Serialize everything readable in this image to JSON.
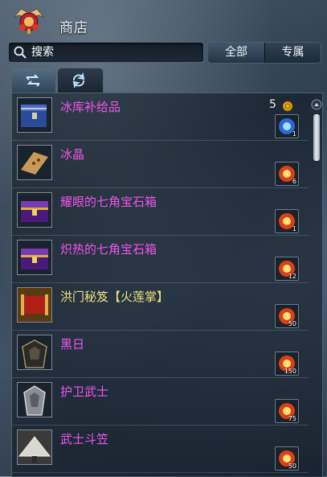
{
  "header": {
    "title": "商店",
    "logo_icon": "lantern-crest-icon"
  },
  "search": {
    "placeholder": "搜索",
    "value": ""
  },
  "filter": {
    "all_label": "全部",
    "own_label": "专属",
    "selected": "全部"
  },
  "tabs": [
    {
      "icon": "swap-arrows-icon",
      "active": true
    },
    {
      "icon": "refresh-icon",
      "active": false
    }
  ],
  "list": {
    "price": "5",
    "price_icon": "gold-coin-icon",
    "items": [
      {
        "name": "冰库补给品",
        "icon": "blue-chest-icon",
        "currency_icon": "blue-orb-icon",
        "qty": "1",
        "color": "#ee55ee"
      },
      {
        "name": "冰晶",
        "icon": "crystal-scroll-icon",
        "currency_icon": "fire-orb-icon",
        "qty": "6",
        "color": "#ee55ee"
      },
      {
        "name": "耀眼的七角宝石箱",
        "icon": "purple-chest-icon",
        "currency_icon": "fire-orb-icon",
        "qty": "1",
        "color": "#ee55ee"
      },
      {
        "name": "炽热的七角宝石箱",
        "icon": "purple-chest-icon",
        "currency_icon": "fire-orb-icon",
        "qty": "12",
        "color": "#ee55ee"
      },
      {
        "name": "洪门秘笈【火莲掌】",
        "icon": "scroll-icon",
        "currency_icon": "fire-orb-icon",
        "qty": "50",
        "color": "#f0e080"
      },
      {
        "name": "黑日",
        "icon": "dark-armor-icon",
        "currency_icon": "fire-orb-icon",
        "qty": "150",
        "color": "#ee55ee"
      },
      {
        "name": "护卫武士",
        "icon": "silver-armor-icon",
        "currency_icon": "fire-orb-icon",
        "qty": "75",
        "color": "#ee55ee"
      },
      {
        "name": "武士斗笠",
        "icon": "straw-hat-icon",
        "currency_icon": "fire-orb-icon",
        "qty": "50",
        "color": "#ee55ee"
      }
    ]
  },
  "colors": {
    "item_name": "#ee55ee",
    "item_name_special": "#f0e080",
    "accent": "#4f6479"
  }
}
